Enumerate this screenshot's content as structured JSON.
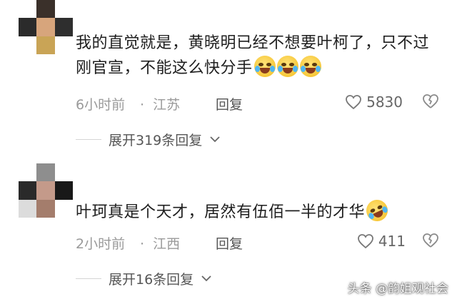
{
  "comments": [
    {
      "text": "我的直觉就是，黄晓明已经不想要叶柯了，只不过刚官宣，不能这么快分手",
      "emojis": [
        "crying-laughing-face-emoji",
        "crying-laughing-face-emoji",
        "crying-laughing-face-emoji"
      ],
      "time": "6小时前",
      "dot": "·",
      "location": "江苏",
      "reply_label": "回复",
      "likes": "5830",
      "expand_label": "展开319条回复"
    },
    {
      "text": "叶珂真是个天才，居然有伍佰一半的才华",
      "emojis": [
        "rolling-laughing-face-emoji"
      ],
      "time": "2小时前",
      "dot": "·",
      "location": "江西",
      "reply_label": "回复",
      "likes": "411",
      "expand_label": "展开16条回复"
    }
  ],
  "watermark": "头条 @韵姐观社会",
  "colors": {
    "text": "#1e1e1e",
    "meta": "#9a9a9a",
    "accent_gray": "#555555",
    "background": "#ffffff"
  }
}
